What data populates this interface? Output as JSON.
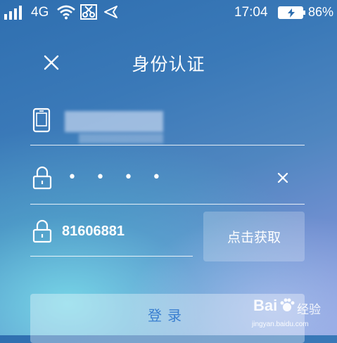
{
  "status_bar": {
    "network": "4G",
    "time": "17:04",
    "battery": "86%",
    "icons": [
      "signal-icon",
      "wifi-icon",
      "scissors-icon",
      "navigation-arrow-icon",
      "battery-charging-icon"
    ]
  },
  "header": {
    "title": "身份认证",
    "close_icon": "close-icon"
  },
  "form": {
    "phone_field": {
      "icon": "phone-icon",
      "value_masked": true
    },
    "password_field": {
      "icon": "lock-icon",
      "dots": "• • • •",
      "clear_icon": "clear-icon"
    },
    "code_field": {
      "icon": "lock-icon",
      "value": "81606881"
    },
    "get_code_button": "点击获取",
    "login_button": "登录"
  },
  "watermark": {
    "brand": "Bai",
    "brand_suffix": "经验",
    "url": "jingyan.baidu.com"
  },
  "colors": {
    "login_text": "#3a7fd0"
  }
}
